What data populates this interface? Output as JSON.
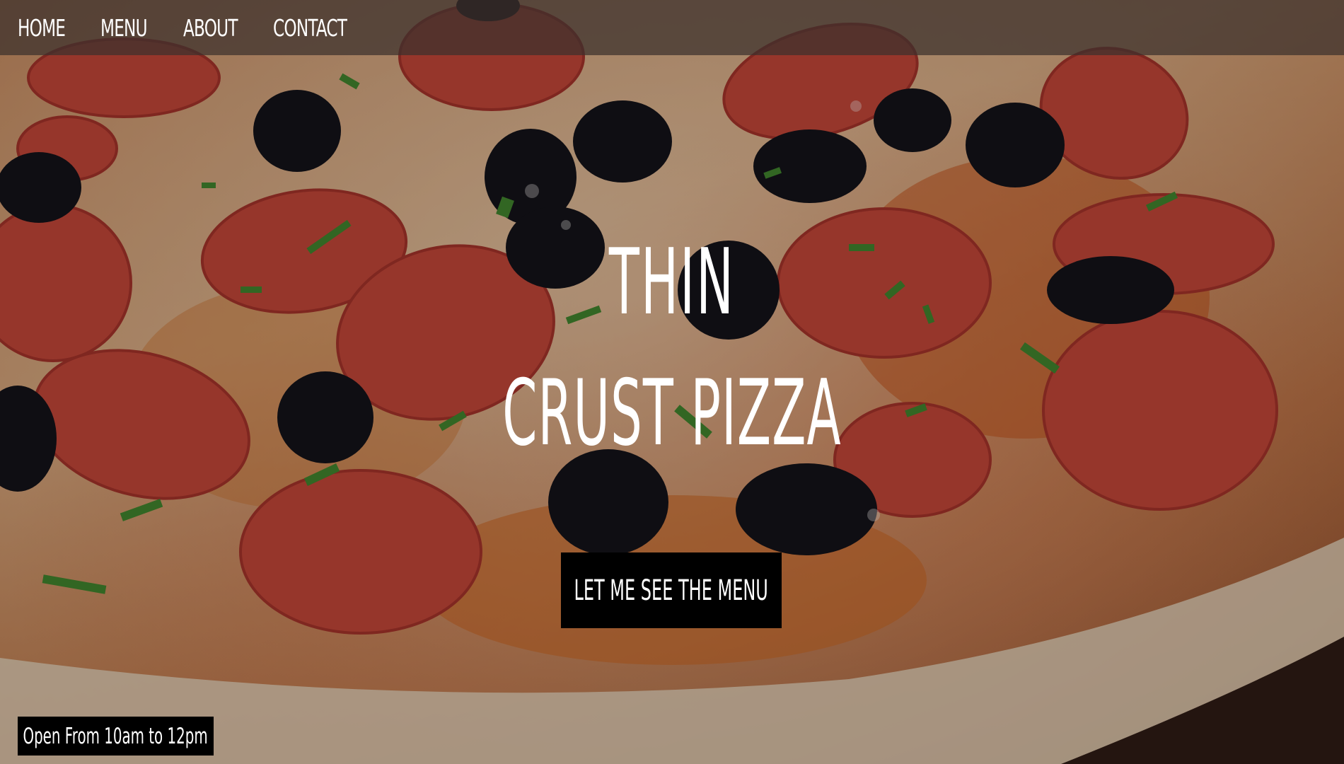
{
  "nav": {
    "items": [
      {
        "label": "HOME"
      },
      {
        "label": "MENU"
      },
      {
        "label": "ABOUT"
      },
      {
        "label": "CONTACT"
      }
    ]
  },
  "hero": {
    "title_line1": "THIN",
    "title_line2": "CRUST PIZZA",
    "cta_label": "LET ME SEE THE MENU",
    "background_subject": "pepperoni and black olive pizza"
  },
  "footer_badge": {
    "text": "Open From 10am to 12pm"
  },
  "colors": {
    "navbar": "#3c302c",
    "button": "#000000",
    "text": "#ffffff"
  }
}
